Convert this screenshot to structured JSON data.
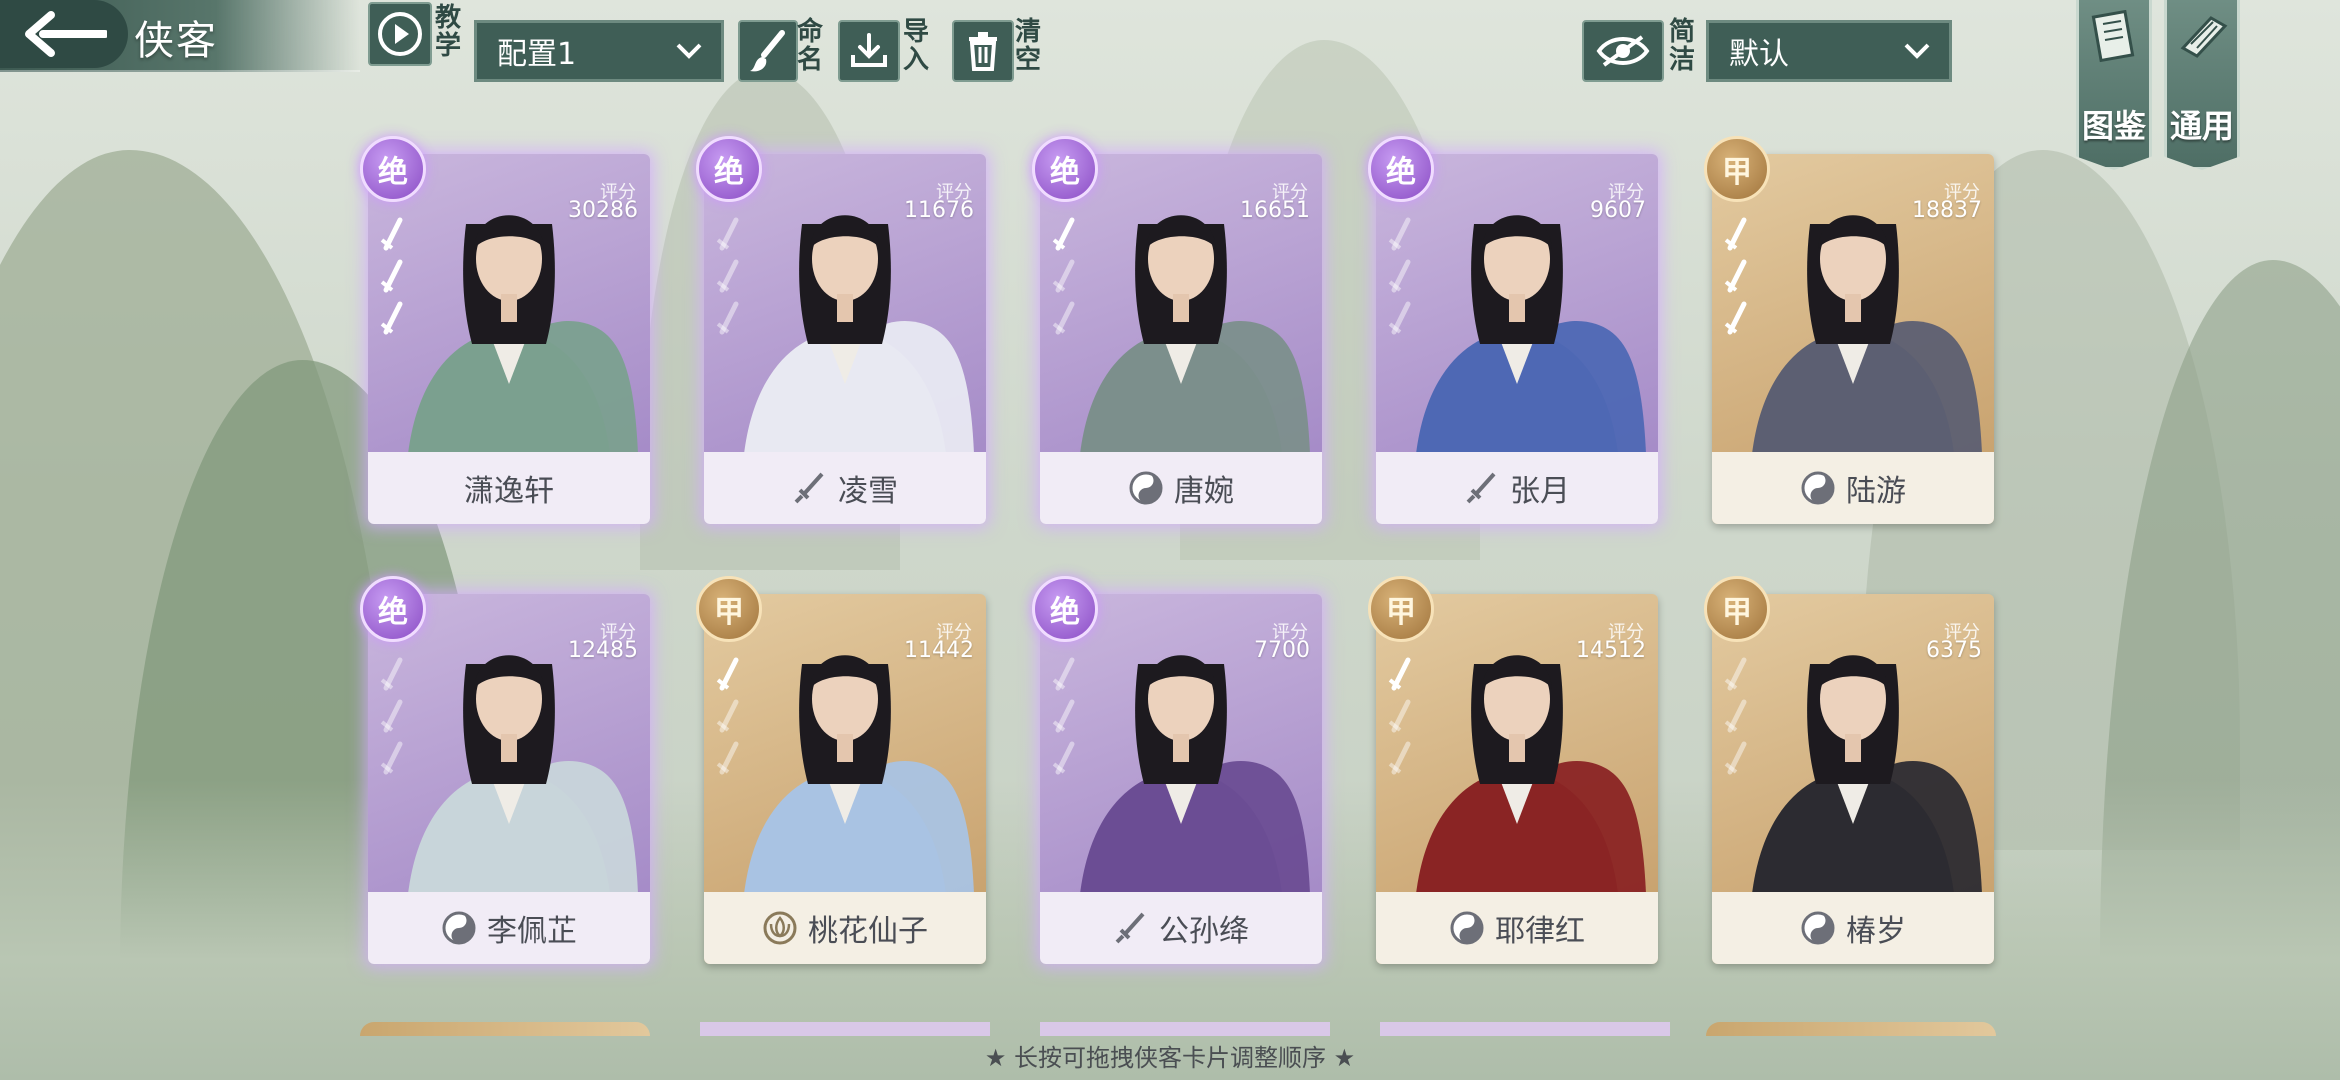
{
  "header": {
    "title": "侠客",
    "tutorial_label": "教学",
    "config_value": "配置1",
    "rename_label": "命名",
    "import_label": "导入",
    "clear_label": "清空",
    "simple_label": "简洁",
    "sort_value": "默认",
    "codex_label": "图鉴",
    "general_label": "通用"
  },
  "score_label": "评分",
  "cards": [
    {
      "name": "潇逸轩",
      "rank": "绝",
      "tier": "jue",
      "score": "30286",
      "swords": 3,
      "lit": 3,
      "icon": "none"
    },
    {
      "name": "凌雪",
      "rank": "绝",
      "tier": "jue",
      "score": "11676",
      "swords": 3,
      "lit": 0,
      "icon": "sword-icon"
    },
    {
      "name": "唐婉",
      "rank": "绝",
      "tier": "jue",
      "score": "16651",
      "swords": 3,
      "lit": 1,
      "icon": "taiji-icon"
    },
    {
      "name": "张月",
      "rank": "绝",
      "tier": "jue",
      "score": "9607",
      "swords": 3,
      "lit": 0,
      "icon": "sword-icon"
    },
    {
      "name": "陆游",
      "rank": "甲",
      "tier": "jia",
      "score": "18837",
      "swords": 3,
      "lit": 3,
      "icon": "taiji-icon"
    },
    {
      "name": "李佩芷",
      "rank": "绝",
      "tier": "jue",
      "score": "12485",
      "swords": 3,
      "lit": 0,
      "icon": "taiji-icon"
    },
    {
      "name": "桃花仙子",
      "rank": "甲",
      "tier": "jia",
      "score": "11442",
      "swords": 3,
      "lit": 1,
      "icon": "lotus-icon"
    },
    {
      "name": "公孙绛",
      "rank": "绝",
      "tier": "jue",
      "score": "7700",
      "swords": 3,
      "lit": 0,
      "icon": "sword-icon"
    },
    {
      "name": "耶律红",
      "rank": "甲",
      "tier": "jia",
      "score": "14512",
      "swords": 3,
      "lit": 1,
      "icon": "taiji-icon"
    },
    {
      "name": "椿岁",
      "rank": "甲",
      "tier": "jia",
      "score": "6375",
      "swords": 3,
      "lit": 0,
      "icon": "taiji-icon"
    }
  ],
  "footer": {
    "hint": "★ 长按可拖拽侠客卡片调整顺序 ★"
  },
  "colors": {
    "jue_accent": "#9f84c4",
    "jia_accent": "#c49c67",
    "panel": "#3f5e56"
  }
}
